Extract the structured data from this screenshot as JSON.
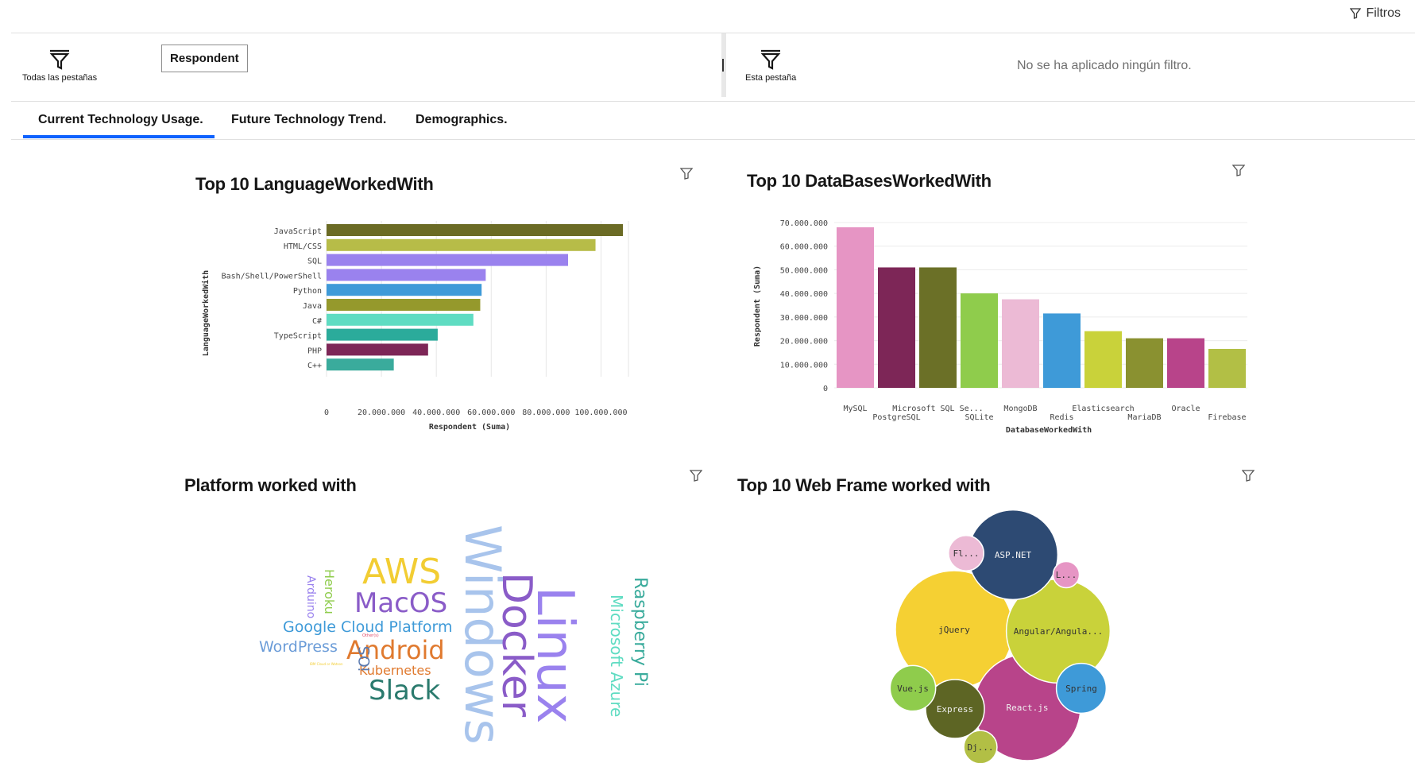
{
  "header": {
    "filters_label": "Filtros"
  },
  "filter_bar": {
    "all_tabs_label": "Todas las pestañas",
    "chip_label": "Respondent",
    "this_tab_label": "Esta pestaña",
    "no_filter_text": "No se ha aplicado ningún filtro."
  },
  "tabs": [
    {
      "label": "Current Technology Usage.",
      "active": true
    },
    {
      "label": "Future Technology Trend.",
      "active": false
    },
    {
      "label": "Demographics.",
      "active": false
    }
  ],
  "panels": {
    "lang_title": "Top 10  LanguageWorkedWith",
    "db_title": "Top 10 DataBasesWorkedWith",
    "platform_title": "Platform worked with",
    "web_title": "Top 10 Web Frame worked with"
  },
  "colors": {
    "accent": "#0f62fe"
  },
  "chart_data": [
    {
      "type": "bar",
      "orientation": "horizontal",
      "title": "Top 10  LanguageWorkedWith",
      "xlabel": "Respondent (Suma)",
      "ylabel": "LanguageWorkedWith",
      "xlim": [
        0,
        110000000
      ],
      "xticks": [
        "0",
        "20.000.000",
        "40.000.000",
        "60.000.000",
        "80.000.000",
        "100.000.000"
      ],
      "grid": true,
      "categories": [
        "JavaScript",
        "HTML/CSS",
        "SQL",
        "Bash/Shell/PowerShell",
        "Python",
        "Java",
        "C#",
        "TypeScript",
        "PHP",
        "C++"
      ],
      "values": [
        108000000,
        98000000,
        88000000,
        58000000,
        56500000,
        56000000,
        53500000,
        40500000,
        37000000,
        24500000
      ],
      "colors": [
        "#6b6b25",
        "#b7bc48",
        "#9a82ee",
        "#9a82ee",
        "#3e9ad8",
        "#95992c",
        "#5fdcc2",
        "#2bab9b",
        "#7d2657",
        "#3aab9c"
      ]
    },
    {
      "type": "bar",
      "title": "Top 10 DataBasesWorkedWith",
      "xlabel": "DatabaseWorkedWith",
      "ylabel": "Respondent (Suma)",
      "ylim": [
        0,
        70000000
      ],
      "yticks": [
        "0",
        "10.000.000",
        "20.000.000",
        "30.000.000",
        "40.000.000",
        "50.000.000",
        "60.000.000",
        "70.000.000"
      ],
      "grid": true,
      "categories": [
        "MySQL",
        "PostgreSQL",
        "Microsoft SQL Se...",
        "SQLite",
        "MongoDB",
        "Redis",
        "Elasticsearch",
        "MariaDB",
        "Oracle",
        "Firebase"
      ],
      "values": [
        68000000,
        51000000,
        51000000,
        40000000,
        37500000,
        31500000,
        24000000,
        21000000,
        21000000,
        16500000
      ],
      "colors": [
        "#e695c4",
        "#7d2657",
        "#6b7027",
        "#8fcc4c",
        "#ecbad5",
        "#3e9ad8",
        "#c9d23a",
        "#8a9130",
        "#b8448a",
        "#b2bf45"
      ]
    },
    {
      "type": "wordcloud",
      "title": "Platform worked with",
      "words": [
        {
          "text": "Windows",
          "color": "#a8c4ec"
        },
        {
          "text": "Linux",
          "color": "#9a82ee"
        },
        {
          "text": "Docker",
          "color": "#8a5cc8"
        },
        {
          "text": "AWS",
          "color": "#f2cd33"
        },
        {
          "text": "MacOS",
          "color": "#8a5cc8"
        },
        {
          "text": "Android",
          "color": "#e07a2f"
        },
        {
          "text": "Slack",
          "color": "#2a7a6d"
        },
        {
          "text": "Microsoft Azure",
          "color": "#5fdcc2"
        },
        {
          "text": "Raspberry Pi",
          "color": "#3aab9c"
        },
        {
          "text": "Google Cloud Platform",
          "color": "#3e9ad8"
        },
        {
          "text": "WordPress",
          "color": "#6b9cd8"
        },
        {
          "text": "Kubernetes",
          "color": "#e07a2f"
        },
        {
          "text": "iOS",
          "color": "#5a7ab0"
        },
        {
          "text": "Heroku",
          "color": "#8fcc4c"
        },
        {
          "text": "Arduino",
          "color": "#9a82ee"
        },
        {
          "text": "Other(s)",
          "color": "#e04b6a"
        },
        {
          "text": "IBM Cloud or Watson",
          "color": "#f2cd33"
        }
      ]
    },
    {
      "type": "bubble",
      "title": "Top 10 Web Frame worked with",
      "items": [
        {
          "label": "jQuery",
          "value": 100,
          "color": "#f5d033"
        },
        {
          "label": "React.js",
          "value": 82,
          "color": "#b8448a"
        },
        {
          "label": "Angular/Angula...",
          "value": 78,
          "color": "#c9d23a"
        },
        {
          "label": "ASP.NET",
          "value": 58,
          "color": "#2d4a73"
        },
        {
          "label": "Express",
          "value": 25,
          "color": "#5d6524"
        },
        {
          "label": "Spring",
          "value": 18,
          "color": "#3e9ad8"
        },
        {
          "label": "Vue.js",
          "value": 15,
          "color": "#8fcc4c"
        },
        {
          "label": "Fl...",
          "value": 9,
          "color": "#ecbad5"
        },
        {
          "label": "Dj...",
          "value": 8,
          "color": "#b2bf45"
        },
        {
          "label": "L...",
          "value": 5,
          "color": "#e695c4"
        }
      ]
    }
  ]
}
